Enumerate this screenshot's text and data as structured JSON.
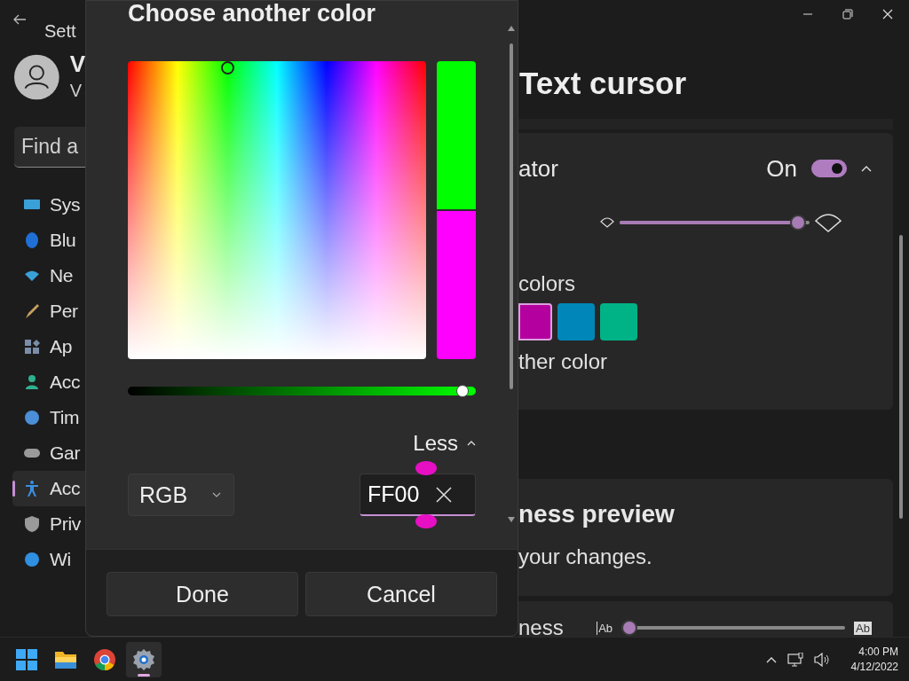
{
  "window": {
    "title": "Sett"
  },
  "sidebar": {
    "user_name": "V",
    "user_email": "V",
    "search": {
      "placeholder": "Find a"
    },
    "items": [
      {
        "label": "Sys",
        "selected": false
      },
      {
        "label": "Blu",
        "selected": false
      },
      {
        "label": "Ne",
        "selected": false
      },
      {
        "label": "Per",
        "selected": false
      },
      {
        "label": "Ap",
        "selected": false
      },
      {
        "label": "Acc",
        "selected": false
      },
      {
        "label": "Tim",
        "selected": false
      },
      {
        "label": "Gar",
        "selected": false
      },
      {
        "label": "Acc",
        "selected": true
      },
      {
        "label": "Priv",
        "selected": false
      },
      {
        "label": "Wi",
        "selected": false
      }
    ]
  },
  "dialog": {
    "title": "Choose another color",
    "preview": [
      {
        "color": "#00ff00"
      },
      {
        "color": "#ff00ff"
      }
    ],
    "brightness": {
      "level": 0.98
    },
    "more_toggle": {
      "label": "Less",
      "expanded": true
    },
    "mode_dropdown": {
      "value": "RGB"
    },
    "hex_field": {
      "value": "FF00"
    },
    "buttons": [
      {
        "label": "Done"
      },
      {
        "label": "Cancel"
      }
    ]
  },
  "content": {
    "title": "Text cursor",
    "indicator": {
      "label": "ator",
      "state_label": "On",
      "on": true,
      "expanded": true,
      "size_slider": {
        "level": 0.98
      }
    },
    "colors_label": "colors",
    "swatches": [
      {
        "color": "#b4009e",
        "selected": true
      },
      {
        "color": "#0086b8",
        "selected": false
      },
      {
        "color": "#00b386",
        "selected": false
      }
    ],
    "other_color": "ther color",
    "preview": {
      "title": "ness preview",
      "subtitle": "your changes."
    },
    "thickness": {
      "label": "ness",
      "min_label": "Ab",
      "max_label": "Ab",
      "level": 0
    }
  },
  "taskbar": {
    "apps": [
      {
        "selected": false
      },
      {
        "selected": false
      },
      {
        "selected": false
      },
      {
        "selected": true
      }
    ],
    "time": "4:00 PM",
    "date": "4/12/2022"
  }
}
